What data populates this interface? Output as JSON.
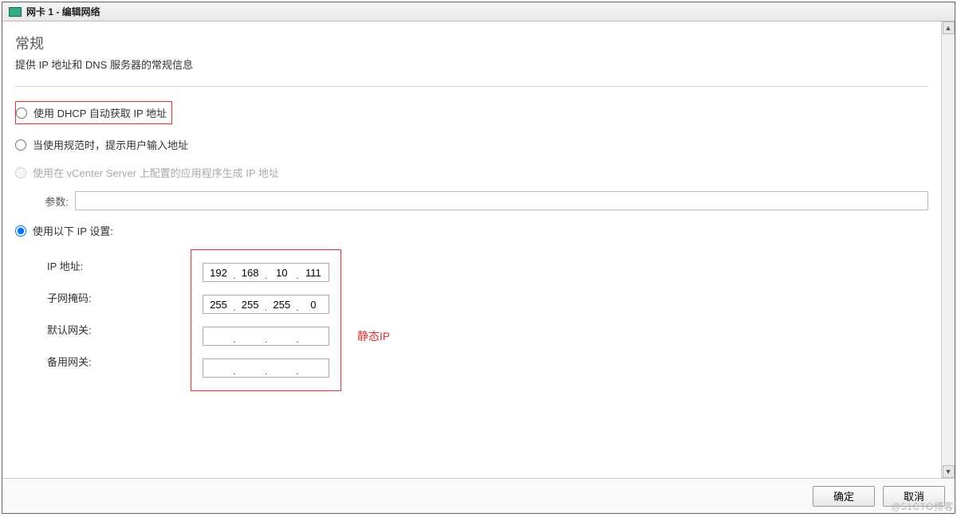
{
  "window": {
    "title": "网卡 1 - 编辑网络"
  },
  "section": {
    "title": "常规",
    "description": "提供 IP 地址和 DNS 服务器的常规信息"
  },
  "options": {
    "dhcp": "使用 DHCP 自动获取 IP 地址",
    "prompt": "当使用规范时，提示用户输入地址",
    "vcenter": "使用在 vCenter Server 上配置的应用程序生成 IP 地址",
    "param_label": "参数:",
    "param_value": "",
    "static": "使用以下 IP 设置:"
  },
  "ip": {
    "labels": {
      "address": "IP 地址:",
      "mask": "子网掩码:",
      "gateway": "默认网关:",
      "alt_gateway": "备用网关:"
    },
    "address": {
      "o1": "192",
      "o2": "168",
      "o3": "10",
      "o4": "111"
    },
    "mask": {
      "o1": "255",
      "o2": "255",
      "o3": "255",
      "o4": "0"
    },
    "gateway": {
      "o1": "",
      "o2": "",
      "o3": "",
      "o4": ""
    },
    "alt_gateway": {
      "o1": "",
      "o2": "",
      "o3": "",
      "o4": ""
    }
  },
  "annotation": "静态IP",
  "buttons": {
    "ok": "确定",
    "cancel": "取消"
  },
  "watermark": "@51CTO博客"
}
